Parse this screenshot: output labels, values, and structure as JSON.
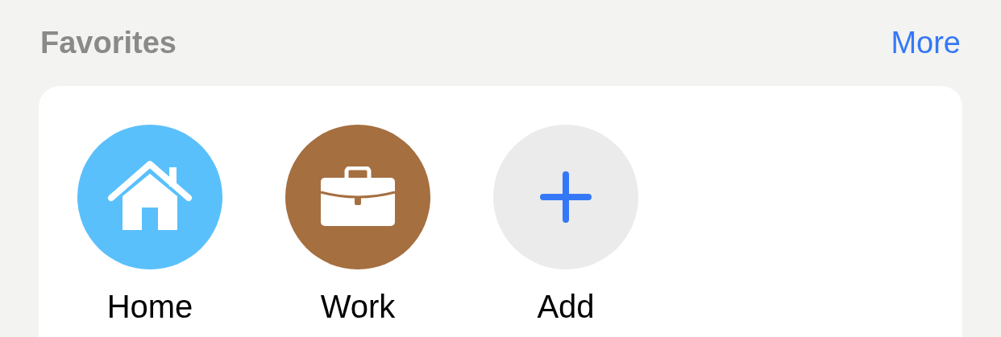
{
  "header": {
    "title": "Favorites",
    "more_link": "More"
  },
  "favorites": [
    {
      "kind": "home",
      "label": "Home",
      "color": "#5ac0fb"
    },
    {
      "kind": "work",
      "label": "Work",
      "color": "#a56f40"
    },
    {
      "kind": "add",
      "label": "Add",
      "color": "#ebebeb"
    }
  ]
}
